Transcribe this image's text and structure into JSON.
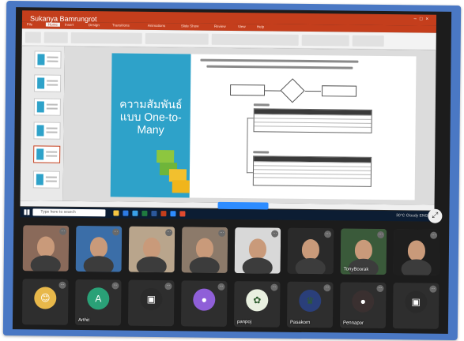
{
  "sharer": {
    "label": "Sukanya Bamrungrot"
  },
  "powerpoint": {
    "title_bar": "",
    "tabs": [
      "File",
      "Home",
      "Insert",
      "Design",
      "Transitions",
      "Animations",
      "Slide Show",
      "Review",
      "View",
      "Help"
    ],
    "active_tab": "Home",
    "slide_title": "ความสัมพันธ์แบบ One-to-Many"
  },
  "taskbar": {
    "search_placeholder": "Type here to search",
    "tray_text": "30°C Cloudy  ENG"
  },
  "share_bar": {
    "stop_label": ""
  },
  "participants_row1": [
    {
      "name": "",
      "kind": "video",
      "color": "#8a6a5a"
    },
    {
      "name": "",
      "kind": "video",
      "color": "#3b6ea8"
    },
    {
      "name": "",
      "kind": "video",
      "color": "#b9a58c"
    },
    {
      "name": "",
      "kind": "video",
      "color": "#8c7a6a"
    },
    {
      "name": "",
      "kind": "video",
      "color": "#d8d8d8"
    },
    {
      "name": "",
      "kind": "video",
      "color": "#2a2a2a"
    },
    {
      "name": "TonyBoorak",
      "kind": "video",
      "color": "#3a5a3a"
    },
    {
      "name": "",
      "kind": "video",
      "color": "#1e1e1e"
    }
  ],
  "participants_row2": [
    {
      "name": "",
      "kind": "emoji",
      "glyph": "😊",
      "color": "#e8b84a"
    },
    {
      "name": "Arthit",
      "kind": "initial",
      "glyph": "A",
      "color": "#2aa177"
    },
    {
      "name": "",
      "kind": "icon",
      "glyph": "▣",
      "color": "#2a2a2a"
    },
    {
      "name": "",
      "kind": "person",
      "glyph": "●",
      "color": "#8f5fd8"
    },
    {
      "name": "panpoj",
      "kind": "logo",
      "glyph": "✿",
      "color": "#e9f0e0"
    },
    {
      "name": "Pasakorn",
      "kind": "logo",
      "glyph": "♛",
      "color": "#2a3f7a"
    },
    {
      "name": "Pennapor",
      "kind": "pet",
      "glyph": "●",
      "color": "#3a3030"
    },
    {
      "name": "",
      "kind": "icon",
      "glyph": "▣",
      "color": "#2a2a2a"
    }
  ]
}
